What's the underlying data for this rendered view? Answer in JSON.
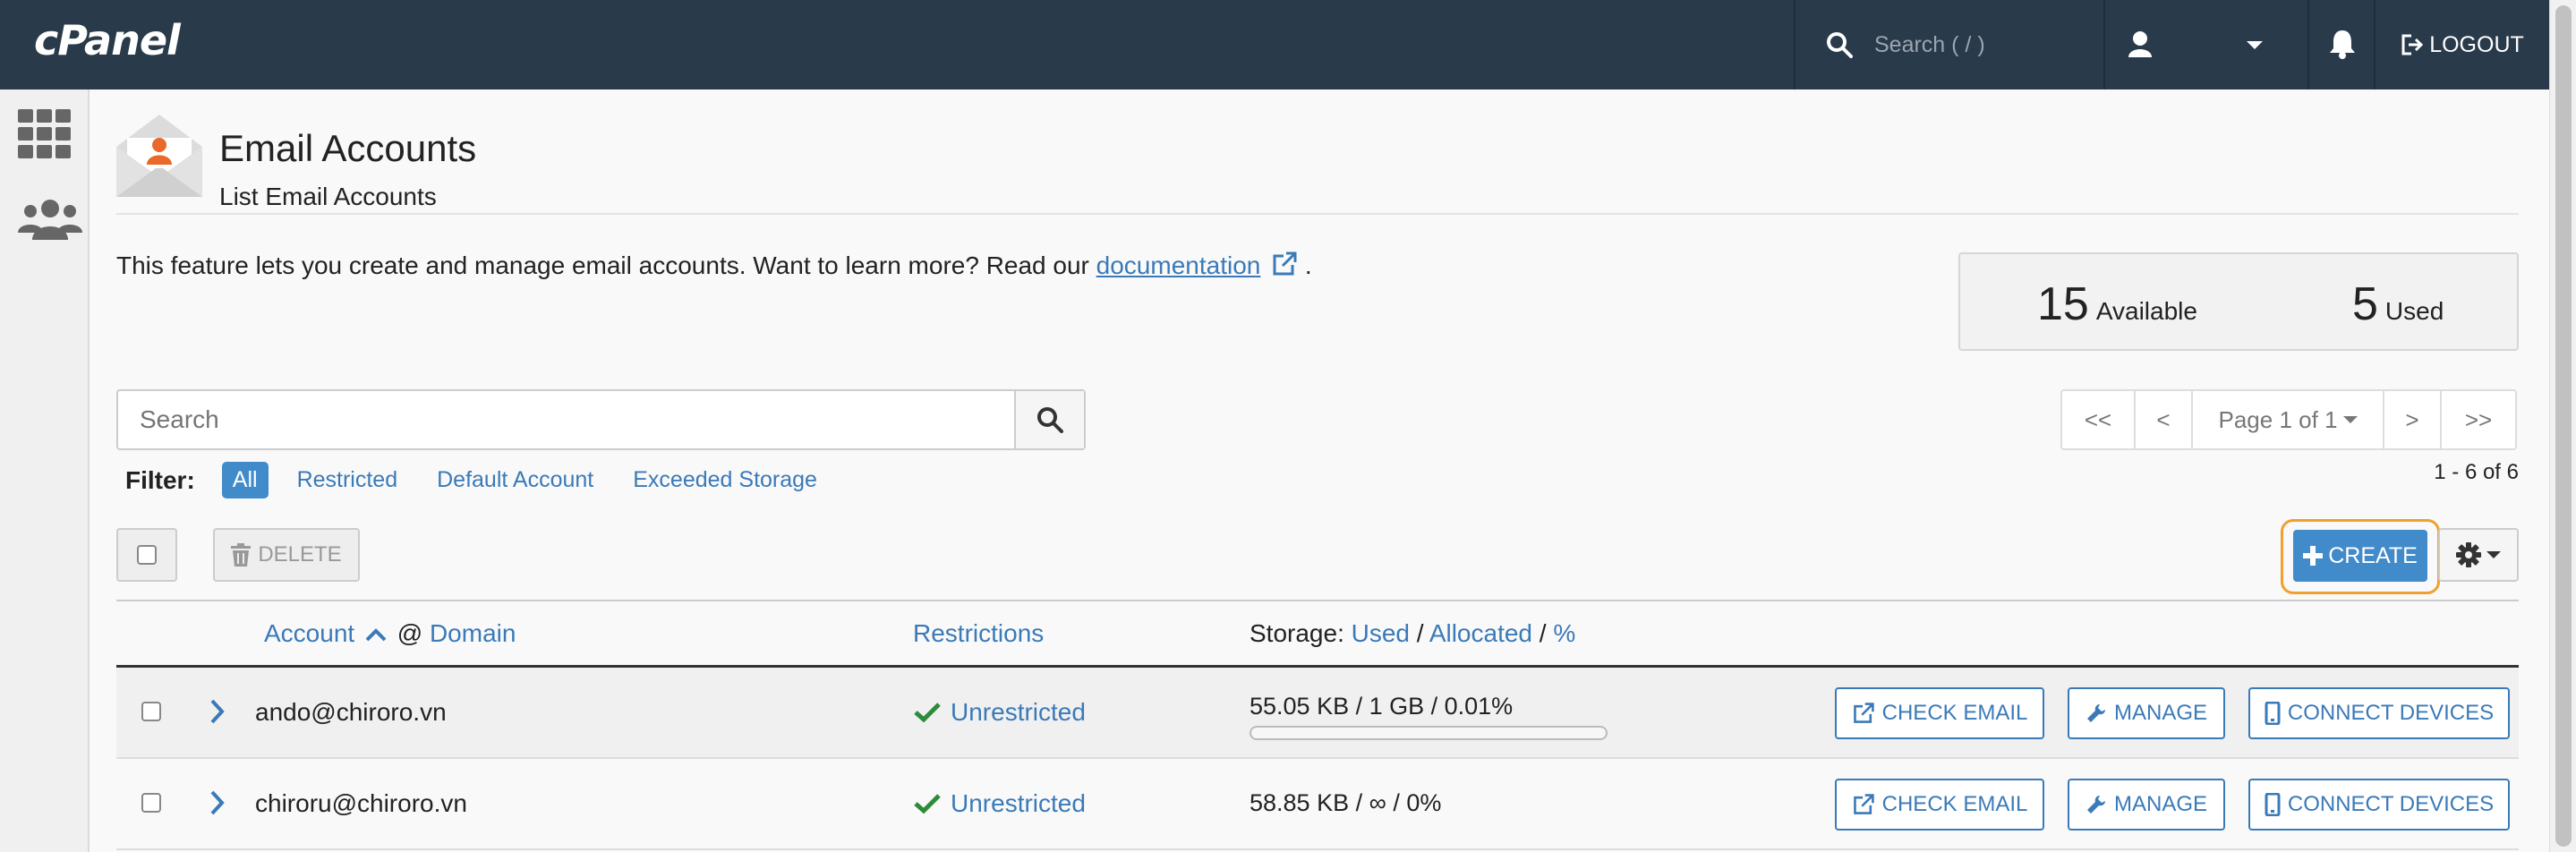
{
  "topbar": {
    "logo": "cPanel",
    "search_placeholder": "Search ( / )",
    "logout_label": "LOGOUT"
  },
  "page": {
    "title": "Email Accounts",
    "subtitle": "List Email Accounts",
    "description_pre": "This feature lets you create and manage email accounts. Want to learn more? Read our ",
    "doc_link": "documentation",
    "description_post": "."
  },
  "stats": {
    "available_num": "15",
    "available_label": "Available",
    "used_num": "5",
    "used_label": "Used"
  },
  "search": {
    "placeholder": "Search"
  },
  "pager": {
    "first": "<<",
    "prev": "<",
    "page_label": "Page 1 of 1",
    "next": ">",
    "last": ">>"
  },
  "filter": {
    "label": "Filter:",
    "all": "All",
    "restricted": "Restricted",
    "default_account": "Default Account",
    "exceeded_storage": "Exceeded Storage"
  },
  "count_text": "1 - 6 of 6",
  "toolbar": {
    "delete_label": "DELETE",
    "create_label": "CREATE"
  },
  "table": {
    "head": {
      "account": "Account",
      "at": "@",
      "domain": "Domain",
      "restrictions": "Restrictions",
      "storage_prefix": "Storage:",
      "used": "Used",
      "slash1": "/",
      "allocated": "Allocated",
      "slash2": "/",
      "pct": "%"
    },
    "rows": [
      {
        "account": "ando@chiroro.vn",
        "restriction": "Unrestricted",
        "storage": "55.05 KB / 1 GB / 0.01%",
        "usage_fraction": 0.0001
      },
      {
        "account": "chiroru@chiroro.vn",
        "restriction": "Unrestricted",
        "storage": "58.85 KB / ∞ / 0%"
      }
    ],
    "row_buttons": {
      "check_email": "CHECK EMAIL",
      "manage": "MANAGE",
      "connect_devices": "CONNECT DEVICES"
    }
  },
  "colors": {
    "topbar_bg": "#293a4a",
    "link": "#3a7ab8",
    "primary": "#428bca",
    "highlight_ring": "#f0a030",
    "success": "#2e8b3a",
    "mail_icon_orange": "#e8692a"
  }
}
